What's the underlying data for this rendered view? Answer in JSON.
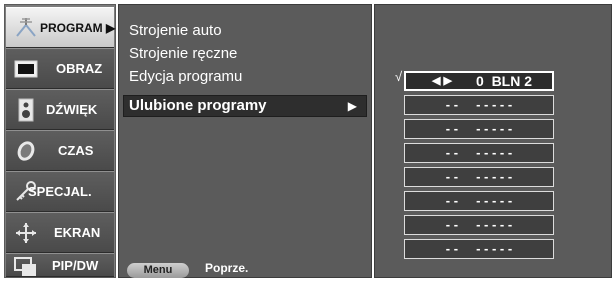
{
  "categories": [
    {
      "label": "PROGRAM ▶",
      "icon": "antenna-icon",
      "selected": true
    },
    {
      "label": "OBRAZ",
      "icon": "screen-icon",
      "selected": false
    },
    {
      "label": "DŹWIĘK",
      "icon": "speaker-icon",
      "selected": false
    },
    {
      "label": "CZAS",
      "icon": "clock-icon",
      "selected": false
    },
    {
      "label": "SPECJAL.",
      "icon": "key-icon",
      "selected": false
    },
    {
      "label": "EKRAN",
      "icon": "move-arrows-icon",
      "selected": false
    },
    {
      "label": "PIP/DW",
      "icon": "pip-icon",
      "selected": false
    }
  ],
  "submenu": {
    "items": [
      "Strojenie auto",
      "Strojenie ręczne",
      "Edycja programu"
    ],
    "selected_item": "Ulubione programy",
    "selected_arrow": "▶",
    "menu_button": "Menu",
    "menu_hint": "Poprze."
  },
  "favorites": {
    "check_mark": "√",
    "selected": {
      "arrows": "◀ ▶",
      "text": "0  BLN 2"
    },
    "empty_rows": [
      "- -     - - - - -",
      "- -     - - - - -",
      "- -     - - - - -",
      "- -     - - - - -",
      "- -     - - - - -",
      "- -     - - - - -",
      "- -     - - - - -"
    ]
  },
  "colors": {
    "selected_category_bg": "#e0e0e0",
    "panel_bg": "#5b5b5b",
    "category_bg": "#555555",
    "text": "#ffffff"
  }
}
